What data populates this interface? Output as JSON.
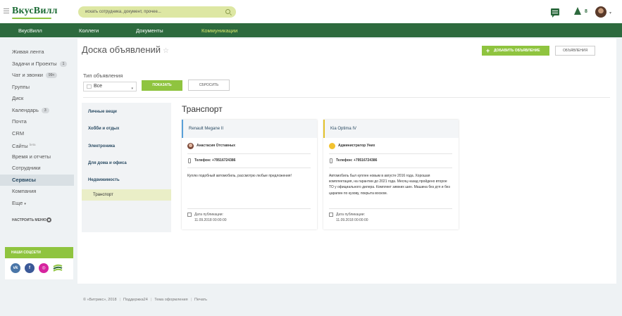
{
  "header": {
    "logo": "ВкусВилл",
    "search_placeholder": "искать сотрудника, документ, прочее...",
    "notifications_count": "8"
  },
  "topnav": [
    {
      "label": "ВкусВилл"
    },
    {
      "label": "Коллеги"
    },
    {
      "label": "Документы"
    },
    {
      "label": "Коммуникации"
    }
  ],
  "sidebar": {
    "items": [
      {
        "label": "Живая лента"
      },
      {
        "label": "Задачи и Проекты",
        "badge": "1"
      },
      {
        "label": "Чат и звонки",
        "badge": "99+"
      },
      {
        "label": "Группы"
      },
      {
        "label": "Диск"
      },
      {
        "label": "Календарь",
        "badge": "3"
      },
      {
        "label": "Почта"
      },
      {
        "label": "CRM"
      },
      {
        "label": "Сайты",
        "sup": "beta"
      },
      {
        "label": "Время и отчеты"
      },
      {
        "label": "Сотрудники"
      },
      {
        "label": "Сервисы"
      },
      {
        "label": "Компания"
      },
      {
        "label": "Еще"
      }
    ],
    "configure_label": "НАСТРОИТЬ МЕНЮ",
    "social_title": "НАШИ СОЦСЕТИ",
    "social_icons": [
      "vk-icon",
      "facebook-icon",
      "instagram-icon",
      "brand-stripes-icon"
    ]
  },
  "page": {
    "title": "Доска объявлений",
    "add_button": "ДОБАВИТЬ ОБЪЯВЛЕНИЕ",
    "announcements_button": "ОБЪЯВЛЕНИЯ"
  },
  "filter": {
    "label": "Тип объявления",
    "selected": "Все",
    "show_button": "ПОКАЗАТЬ",
    "reset_button": "СБРОСИТЬ"
  },
  "categories": [
    {
      "label": "Личные вещи"
    },
    {
      "label": "Хобби и отдых"
    },
    {
      "label": "Электроника"
    },
    {
      "label": "Для дома и офиса"
    },
    {
      "label": "Недвижимость"
    }
  ],
  "subcategory": "Транспорт",
  "section_title": "Транспорт",
  "cards": [
    {
      "title": "Renault Megane II",
      "accent": "#5aa0d8",
      "author": "Анастасия Отставных",
      "phone": "Телефон: +79516724386",
      "text": "Куплю подобный автомобиль, рассмотрю любые предложения!",
      "date_label": "Дата публикации:",
      "date": "11.09.2018 00:00:00"
    },
    {
      "title": "Kia Optima IV",
      "accent": "#e3c22a",
      "author": "Администратор Униx",
      "phone": "Телефон: +79516724386",
      "text": "Автомобиль был куплен новым в августе 2016 года. Хорошая комплектация, на гарантии до 2021 года. Месяц назад пройдено второе ТО у официального дилера. Комплект зимних шин. Машина без дтп и без царапин по кузову, покрыта воском.",
      "date_label": "Дата публикации:",
      "date": "11.09.2018 00:00:00"
    }
  ],
  "footer": {
    "copyright": "© «Битрикс», 2018",
    "support": "Поддержка24",
    "theme": "Тема оформления",
    "print": "Печать"
  },
  "colors": {
    "brand_green": "#2d6a3e",
    "accent_green": "#8fc43f",
    "active_nav": "#dbe86b"
  }
}
